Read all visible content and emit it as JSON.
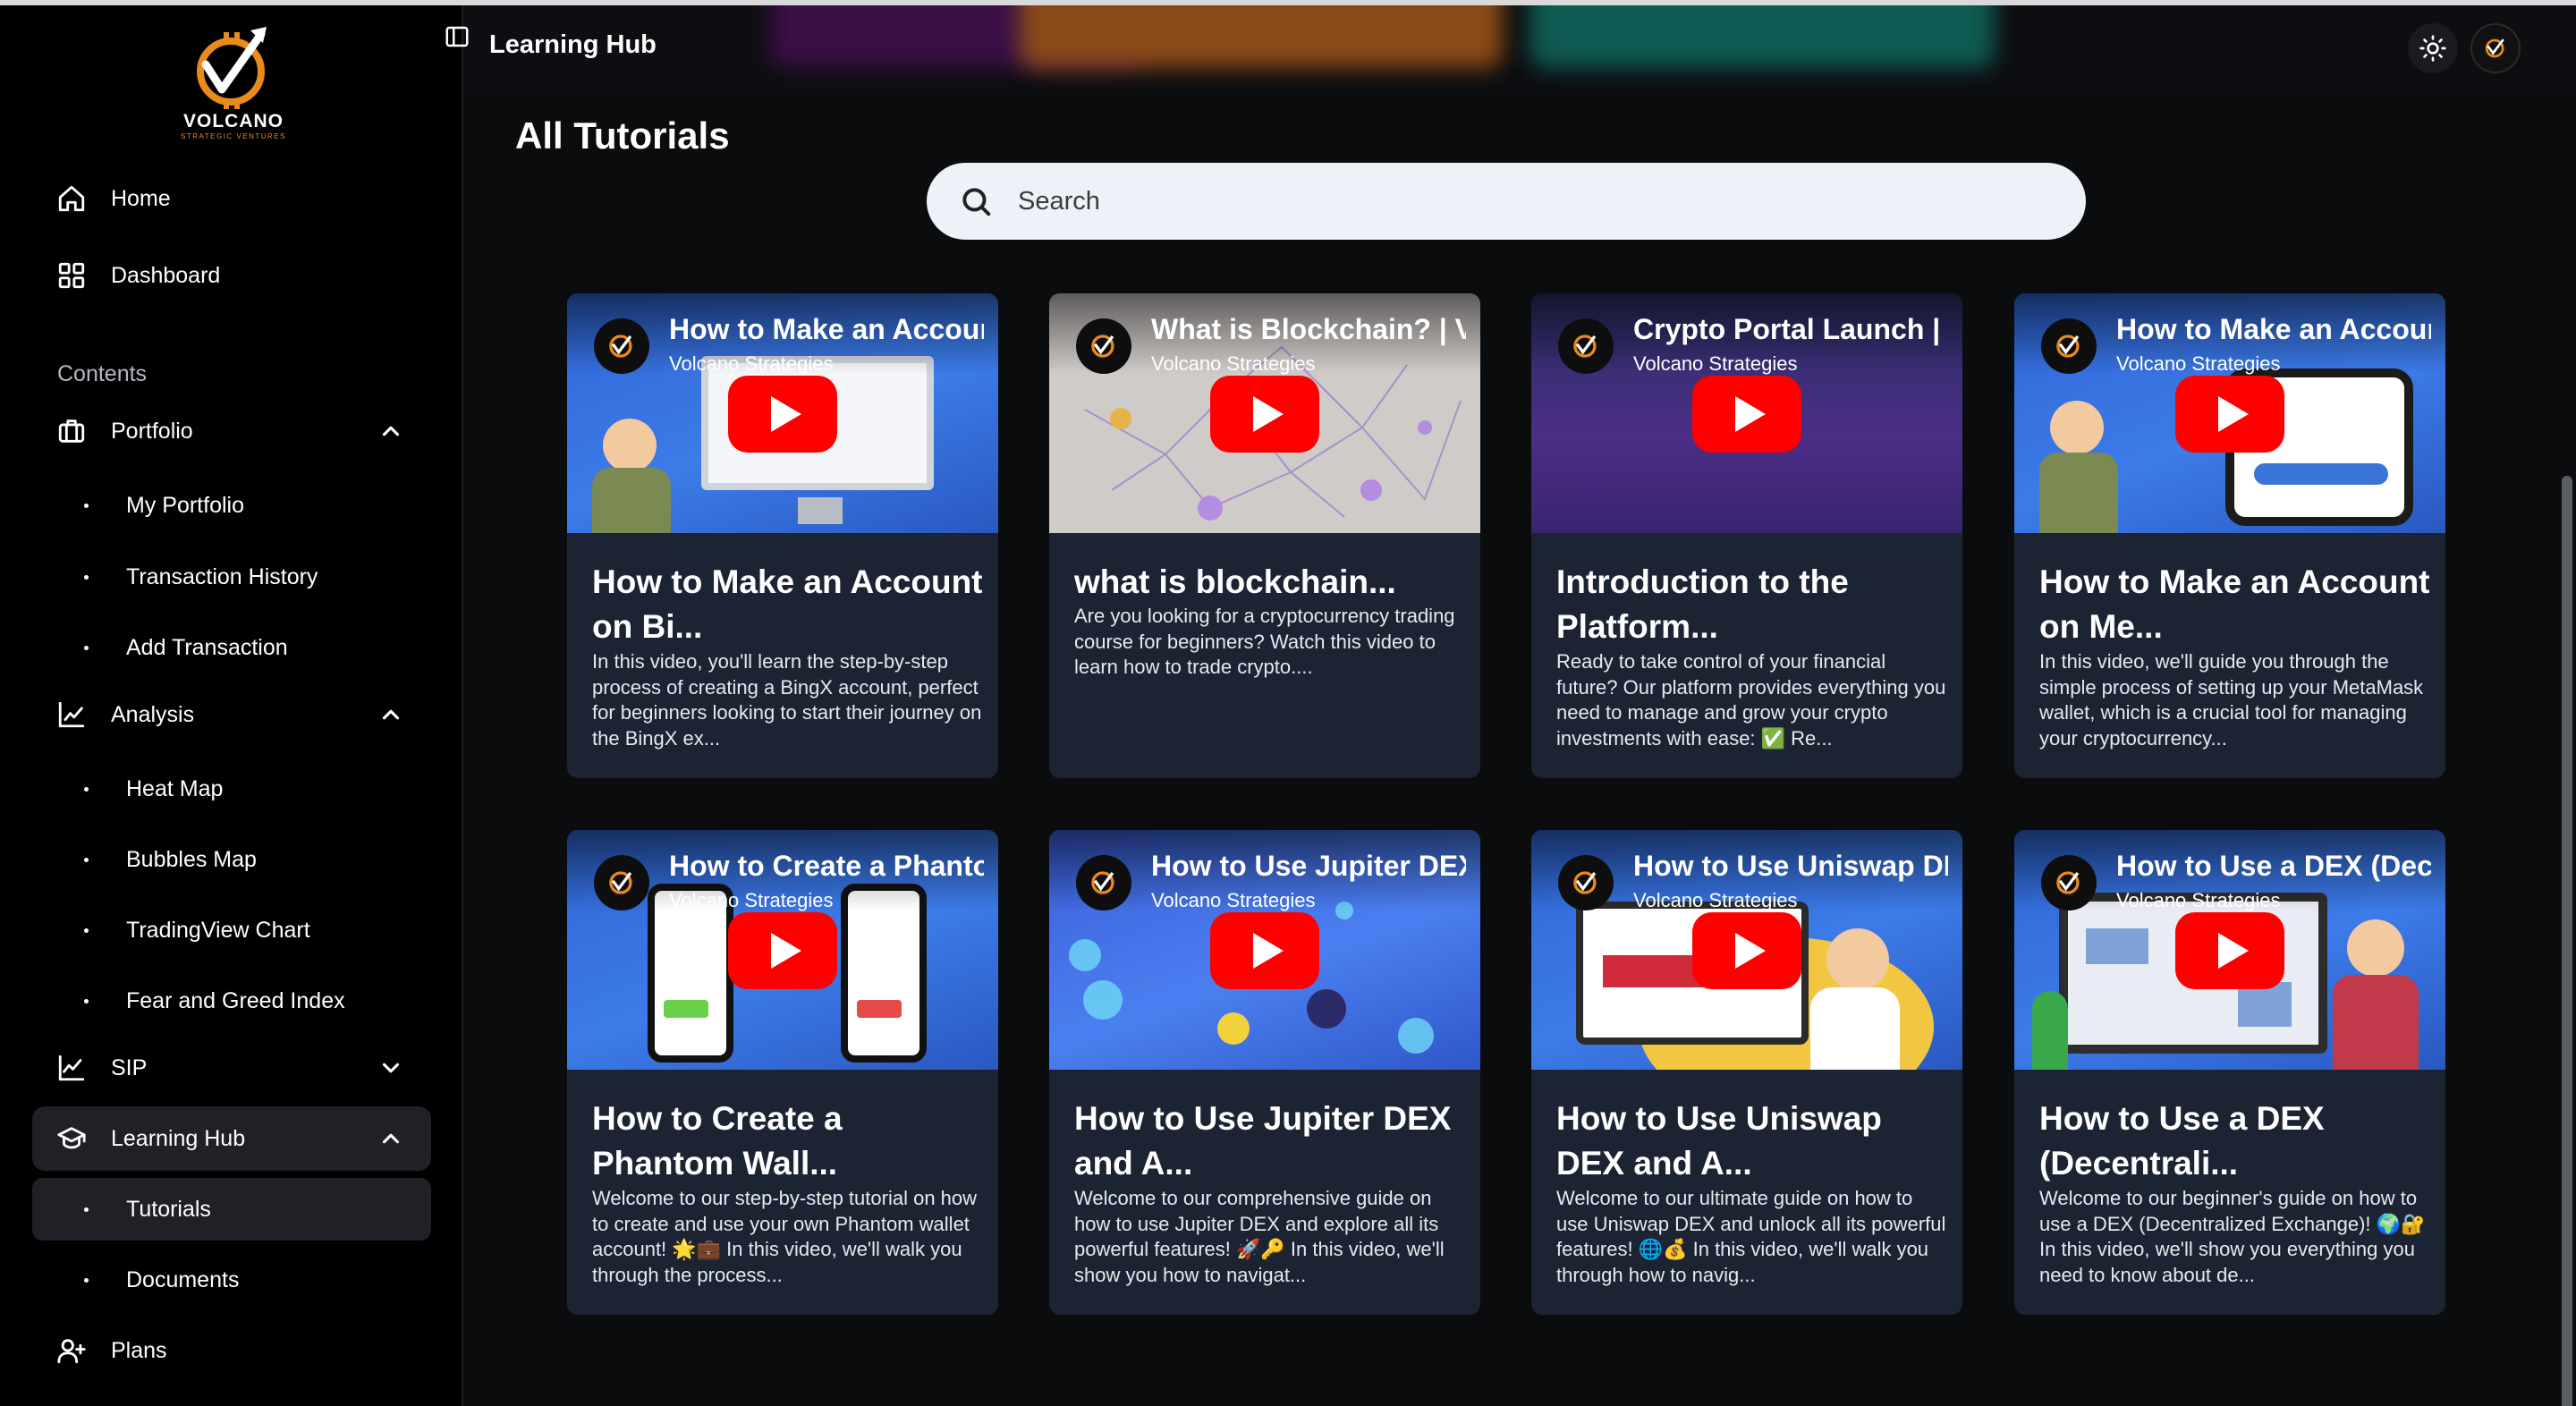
{
  "brand": {
    "name": "VOLCANO",
    "tagline": "STRATEGIC VENTURES",
    "accent": "#e98a1c"
  },
  "header": {
    "title": "Learning Hub"
  },
  "sidebar": {
    "top_items": [
      {
        "label": "Home",
        "icon": "home-icon"
      },
      {
        "label": "Dashboard",
        "icon": "grid-icon"
      }
    ],
    "section_label": "Contents",
    "groups": [
      {
        "label": "Portfolio",
        "icon": "briefcase-icon",
        "expanded": true,
        "items": [
          "My Portfolio",
          "Transaction History",
          "Add Transaction"
        ]
      },
      {
        "label": "Analysis",
        "icon": "chart-icon",
        "expanded": true,
        "items": [
          "Heat Map",
          "Bubbles Map",
          "TradingView Chart",
          "Fear and Greed Index"
        ]
      },
      {
        "label": "SIP",
        "icon": "line-chart-icon",
        "expanded": false,
        "items": []
      },
      {
        "label": "Learning Hub",
        "icon": "graduation-cap-icon",
        "expanded": true,
        "items": [
          "Tutorials",
          "Documents"
        ]
      }
    ],
    "bottom_items": [
      {
        "label": "Plans",
        "icon": "user-plus-icon"
      }
    ],
    "active_item": "Tutorials"
  },
  "main": {
    "title": "All Tutorials",
    "search_placeholder": "Search",
    "cards": [
      {
        "video_title": "How to Make an Accoun",
        "channel": "Volcano Strategies",
        "title": "How to Make an Account on Bi...",
        "desc": "In this video, you'll learn the step-by-step process of creating a BingX account, perfect for beginners looking to start their journey on the BingX ex..."
      },
      {
        "video_title": "What is Blockchain? | Vo",
        "channel": "Volcano Strategies",
        "title": "what is blockchain...",
        "desc": "Are you looking for a cryptocurrency trading course for beginners? Watch this video to learn how to trade crypto...."
      },
      {
        "video_title": "Crypto Portal Launch | V",
        "channel": "Volcano Strategies",
        "title": "Introduction to the Platform...",
        "desc": "Ready to take control of your financial future? Our platform provides everything you need to manage and grow your crypto investments with ease: ✅ Re..."
      },
      {
        "video_title": "How to Make an Accour",
        "channel": "Volcano Strategies",
        "title": "How to Make an Account on Me...",
        "desc": "In this video, we'll guide you through the simple process of setting up your MetaMask wallet, which is a crucial tool for managing your cryptocurrency..."
      },
      {
        "video_title": "How to Create a Phanto",
        "channel": "Volcano Strategies",
        "title": "How to Create a Phantom Wall...",
        "desc": "Welcome to our step-by-step tutorial on how to create and use your own Phantom wallet account! 🌟💼 In this video, we'll walk you through the process..."
      },
      {
        "video_title": "How to Use Jupiter DEX",
        "channel": "Volcano Strategies",
        "title": "How to Use Jupiter DEX and A...",
        "desc": "Welcome to our comprehensive guide on how to use Jupiter DEX and explore all its powerful features! 🚀🔑 In this video, we'll show you how to navigat..."
      },
      {
        "video_title": "How to Use Uniswap DE",
        "channel": "Volcano Strategies",
        "title": "How to Use Uniswap DEX and A...",
        "desc": "Welcome to our ultimate guide on how to use Uniswap DEX and unlock all its powerful features! 🌐💰 In this video, we'll walk you through how to navig..."
      },
      {
        "video_title": "How to Use a DEX (Dece",
        "channel": "Volcano Strategies",
        "title": "How to Use a DEX (Decentrali...",
        "desc": "Welcome to our beginner's guide on how to use a DEX (Decentralized Exchange)! 🌍🔐 In this video, we'll show you everything you need to know about de..."
      }
    ]
  }
}
